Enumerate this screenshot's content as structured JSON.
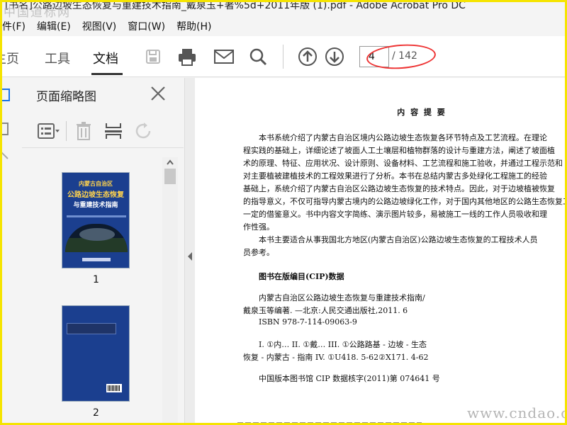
{
  "window": {
    "title": "[书名]公路边坡生态恢复与重建技术指南_戴泉玉+著%5d+2011年版 (1).pdf - Adobe Acrobat Pro DC"
  },
  "watermarks": {
    "top_left": "中国道标网",
    "bottom_right": "www.cndao.com"
  },
  "menubar": {
    "items": [
      "件(F)",
      "编辑(E)",
      "视图(V)",
      "窗口(W)",
      "帮助(H)"
    ]
  },
  "toolbar": {
    "tabs": [
      "主页",
      "工具",
      "文档"
    ],
    "active_tab": "文档",
    "page_input": "4",
    "page_total": "/ 142",
    "icons": [
      "save-icon",
      "print-icon",
      "email-icon",
      "search-icon",
      "arrow-up-icon",
      "arrow-down-icon"
    ]
  },
  "sidebar": {
    "title": "页面缩略图",
    "tools": [
      "thumbnail-options-icon",
      "delete-icon",
      "insert-page-icon",
      "rotate-icon"
    ],
    "thumbnails": [
      {
        "page": "1",
        "cover_title_top": "内蒙古自治区",
        "cover_title_main": "公路边坡生态恢复",
        "cover_title_sub": "与重建技术指南"
      },
      {
        "page": "2"
      }
    ]
  },
  "document": {
    "heading": "内 容 提 要",
    "summary_lines": [
      "本书系统介绍了内蒙古自治区境内公路边坡生态恢复各环节特点及工艺流程。在理论",
      "程实践的基础上，详细论述了坡面人工土壤层和植物群落的设计与重建方法，阐述了坡面植",
      "术的原理、特征、应用状况、设计原则、设备材料、工艺流程和施工验收，并通过工程示范和",
      "对主要植被建植技术的工程效果进行了分析。本书在总结内蒙古多处绿化工程施工的经验",
      "基础上，系统介绍了内蒙古自治区公路边坡生态恢复的技术特点。因此，对于边坡植被恢复",
      "的指导意义，不仅可指导内蒙古境内的公路边坡绿化工作，对于国内其他地区的公路生态恢复工",
      "一定的借鉴意义。书中内容文字简练、演示图片较多，易被施工一线的工作人员吸收和理",
      "作性强。",
      "本书主要适合从事我国北方地区(内蒙古自治区)公路边坡生态恢复的工程技术人员",
      "员参考。"
    ],
    "cip_heading": "图书在版编目(CIP)数据",
    "cip_lines": [
      "内蒙古自治区公路边坡生态恢复与重建技术指南/",
      "戴泉玉等编著. —北京:人民交通出版社,2011. 6",
      "ISBN 978-7-114-09063-9",
      "I. ①内…   II. ①戴…   III. ①公路路基 - 边坡 - 生态",
      "恢复 - 内蒙古 - 指南   IV. ①U418. 5-62②X171. 4-62",
      "中国版本图书馆 CIP 数据核字(2011)第 074641 号"
    ]
  },
  "colors": {
    "accent": "#1b3f8f",
    "annotation": "#ee3333",
    "border": "#f5e400"
  }
}
